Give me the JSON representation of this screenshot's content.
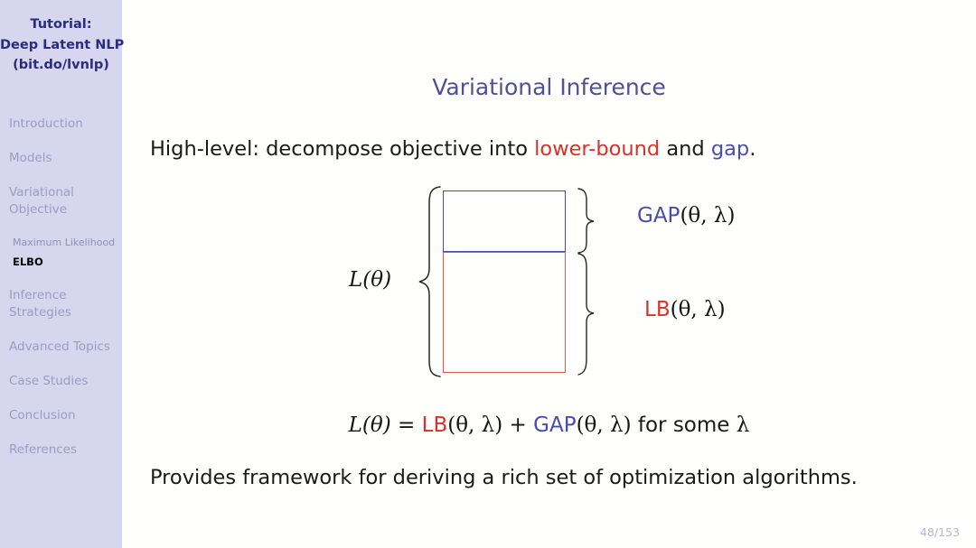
{
  "sidebar": {
    "title_lines": [
      "Tutorial:",
      "Deep Latent NLP",
      "(bit.do/lvnlp)"
    ],
    "items": [
      {
        "label": "Introduction",
        "level": "top",
        "active": false
      },
      {
        "label": "Models",
        "level": "top",
        "active": false
      },
      {
        "label": "Variational Objective",
        "level": "top",
        "active": false,
        "line1": "Variational",
        "line2": "Objective"
      },
      {
        "label": "Maximum Likelihood",
        "level": "sub",
        "active": false
      },
      {
        "label": "ELBO",
        "level": "sub",
        "active": true
      },
      {
        "label": "Inference Strategies",
        "level": "top",
        "active": false,
        "line1": "Inference",
        "line2": "Strategies"
      },
      {
        "label": "Advanced Topics",
        "level": "top",
        "active": false
      },
      {
        "label": "Case Studies",
        "level": "top",
        "active": false
      },
      {
        "label": "Conclusion",
        "level": "top",
        "active": false
      },
      {
        "label": "References",
        "level": "top",
        "active": false
      }
    ]
  },
  "slide": {
    "title": "Variational Inference",
    "high_level": {
      "prefix": "High-level:  decompose objective into ",
      "red_term": "lower-bound",
      "middle": " and ",
      "blue_term": "gap",
      "suffix": "."
    },
    "provides": "Provides framework for deriving a rich set of optimization algorithms.",
    "equation": {
      "lhs": "L(θ)",
      "eq": " = ",
      "lb": "LB",
      "lb_args": "(θ, λ)",
      "plus": " + ",
      "gap": "GAP",
      "gap_args": "(θ, λ)",
      "tail": " for some ",
      "lambda": "λ"
    },
    "page_number": "48/153"
  },
  "diagram": {
    "left_label": "L(θ)",
    "gap_label": "GAP",
    "gap_args": "(θ, λ)",
    "lb_label": "LB",
    "lb_args": "(θ, λ)"
  },
  "colors": {
    "sidebar_bg": "#d6d6ef",
    "sidebar_title": "#2b2b80",
    "nav_text": "#9c9cc0",
    "title": "#4f4f9c",
    "red": "#e12e26",
    "blue": "#4b4bab",
    "page_number": "#b7b7d4"
  }
}
